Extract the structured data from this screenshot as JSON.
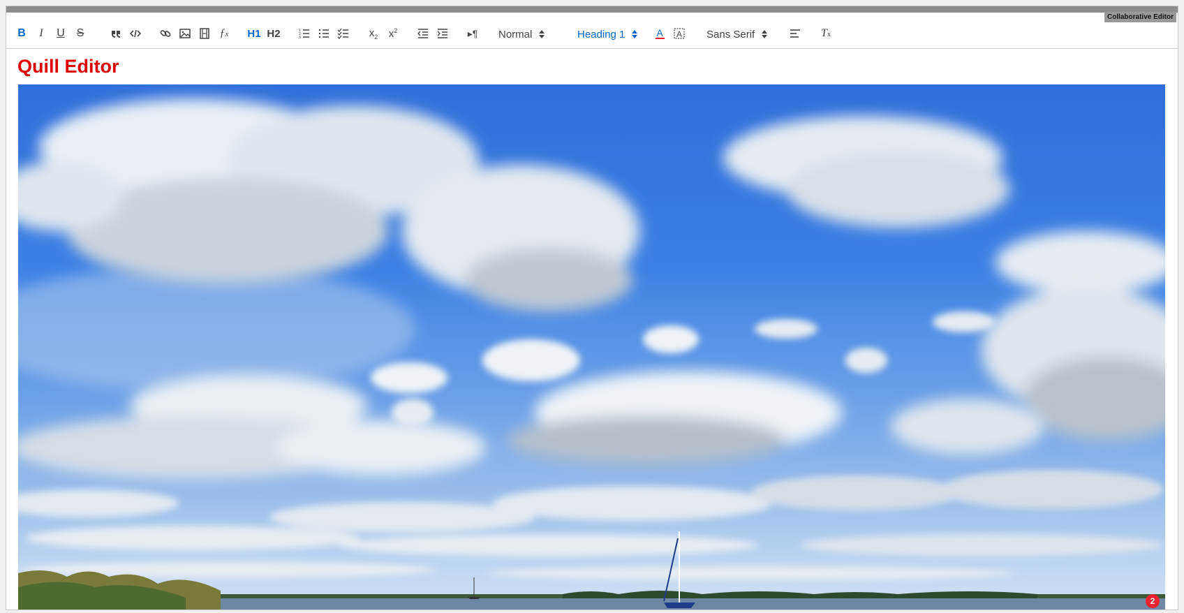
{
  "window": {
    "tag": "Collaborative Editor"
  },
  "toolbar": {
    "buttons": [
      {
        "name": "bold",
        "glyph": "B"
      },
      {
        "name": "italic",
        "glyph": "I"
      },
      {
        "name": "underline",
        "glyph": "U"
      },
      {
        "name": "strike",
        "glyph": "S"
      }
    ],
    "heading1_label": "H1",
    "heading2_label": "H2",
    "format_select": "Normal",
    "heading_select": "Heading 1",
    "font_select": "Sans Serif",
    "subscript": "x2",
    "superscript": "x2"
  },
  "editor": {
    "title": "Quill Editor",
    "image_description_visible": false
  },
  "notifications": {
    "count": "2"
  },
  "colors": {
    "accent": "#0066cc",
    "title": "#e00000",
    "badge": "#e8232f"
  }
}
